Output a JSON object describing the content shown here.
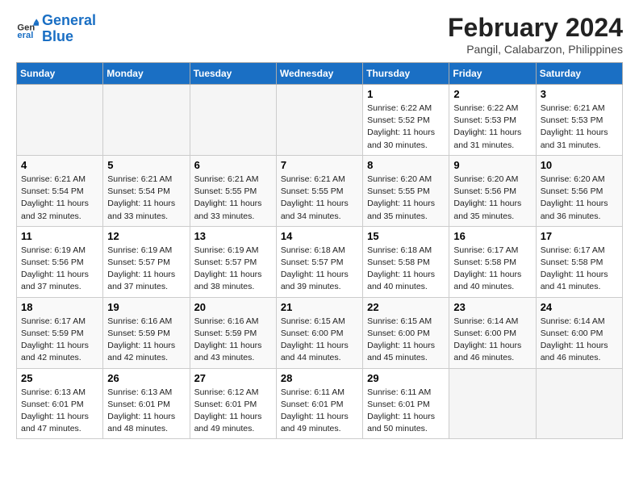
{
  "logo": {
    "line1": "General",
    "line2": "Blue"
  },
  "title": "February 2024",
  "subtitle": "Pangil, Calabarzon, Philippines",
  "days_of_week": [
    "Sunday",
    "Monday",
    "Tuesday",
    "Wednesday",
    "Thursday",
    "Friday",
    "Saturday"
  ],
  "weeks": [
    [
      {
        "day": "",
        "info": ""
      },
      {
        "day": "",
        "info": ""
      },
      {
        "day": "",
        "info": ""
      },
      {
        "day": "",
        "info": ""
      },
      {
        "day": "1",
        "info": "Sunrise: 6:22 AM\nSunset: 5:52 PM\nDaylight: 11 hours and 30 minutes."
      },
      {
        "day": "2",
        "info": "Sunrise: 6:22 AM\nSunset: 5:53 PM\nDaylight: 11 hours and 31 minutes."
      },
      {
        "day": "3",
        "info": "Sunrise: 6:21 AM\nSunset: 5:53 PM\nDaylight: 11 hours and 31 minutes."
      }
    ],
    [
      {
        "day": "4",
        "info": "Sunrise: 6:21 AM\nSunset: 5:54 PM\nDaylight: 11 hours and 32 minutes."
      },
      {
        "day": "5",
        "info": "Sunrise: 6:21 AM\nSunset: 5:54 PM\nDaylight: 11 hours and 33 minutes."
      },
      {
        "day": "6",
        "info": "Sunrise: 6:21 AM\nSunset: 5:55 PM\nDaylight: 11 hours and 33 minutes."
      },
      {
        "day": "7",
        "info": "Sunrise: 6:21 AM\nSunset: 5:55 PM\nDaylight: 11 hours and 34 minutes."
      },
      {
        "day": "8",
        "info": "Sunrise: 6:20 AM\nSunset: 5:55 PM\nDaylight: 11 hours and 35 minutes."
      },
      {
        "day": "9",
        "info": "Sunrise: 6:20 AM\nSunset: 5:56 PM\nDaylight: 11 hours and 35 minutes."
      },
      {
        "day": "10",
        "info": "Sunrise: 6:20 AM\nSunset: 5:56 PM\nDaylight: 11 hours and 36 minutes."
      }
    ],
    [
      {
        "day": "11",
        "info": "Sunrise: 6:19 AM\nSunset: 5:56 PM\nDaylight: 11 hours and 37 minutes."
      },
      {
        "day": "12",
        "info": "Sunrise: 6:19 AM\nSunset: 5:57 PM\nDaylight: 11 hours and 37 minutes."
      },
      {
        "day": "13",
        "info": "Sunrise: 6:19 AM\nSunset: 5:57 PM\nDaylight: 11 hours and 38 minutes."
      },
      {
        "day": "14",
        "info": "Sunrise: 6:18 AM\nSunset: 5:57 PM\nDaylight: 11 hours and 39 minutes."
      },
      {
        "day": "15",
        "info": "Sunrise: 6:18 AM\nSunset: 5:58 PM\nDaylight: 11 hours and 40 minutes."
      },
      {
        "day": "16",
        "info": "Sunrise: 6:17 AM\nSunset: 5:58 PM\nDaylight: 11 hours and 40 minutes."
      },
      {
        "day": "17",
        "info": "Sunrise: 6:17 AM\nSunset: 5:58 PM\nDaylight: 11 hours and 41 minutes."
      }
    ],
    [
      {
        "day": "18",
        "info": "Sunrise: 6:17 AM\nSunset: 5:59 PM\nDaylight: 11 hours and 42 minutes."
      },
      {
        "day": "19",
        "info": "Sunrise: 6:16 AM\nSunset: 5:59 PM\nDaylight: 11 hours and 42 minutes."
      },
      {
        "day": "20",
        "info": "Sunrise: 6:16 AM\nSunset: 5:59 PM\nDaylight: 11 hours and 43 minutes."
      },
      {
        "day": "21",
        "info": "Sunrise: 6:15 AM\nSunset: 6:00 PM\nDaylight: 11 hours and 44 minutes."
      },
      {
        "day": "22",
        "info": "Sunrise: 6:15 AM\nSunset: 6:00 PM\nDaylight: 11 hours and 45 minutes."
      },
      {
        "day": "23",
        "info": "Sunrise: 6:14 AM\nSunset: 6:00 PM\nDaylight: 11 hours and 46 minutes."
      },
      {
        "day": "24",
        "info": "Sunrise: 6:14 AM\nSunset: 6:00 PM\nDaylight: 11 hours and 46 minutes."
      }
    ],
    [
      {
        "day": "25",
        "info": "Sunrise: 6:13 AM\nSunset: 6:01 PM\nDaylight: 11 hours and 47 minutes."
      },
      {
        "day": "26",
        "info": "Sunrise: 6:13 AM\nSunset: 6:01 PM\nDaylight: 11 hours and 48 minutes."
      },
      {
        "day": "27",
        "info": "Sunrise: 6:12 AM\nSunset: 6:01 PM\nDaylight: 11 hours and 49 minutes."
      },
      {
        "day": "28",
        "info": "Sunrise: 6:11 AM\nSunset: 6:01 PM\nDaylight: 11 hours and 49 minutes."
      },
      {
        "day": "29",
        "info": "Sunrise: 6:11 AM\nSunset: 6:01 PM\nDaylight: 11 hours and 50 minutes."
      },
      {
        "day": "",
        "info": ""
      },
      {
        "day": "",
        "info": ""
      }
    ]
  ]
}
